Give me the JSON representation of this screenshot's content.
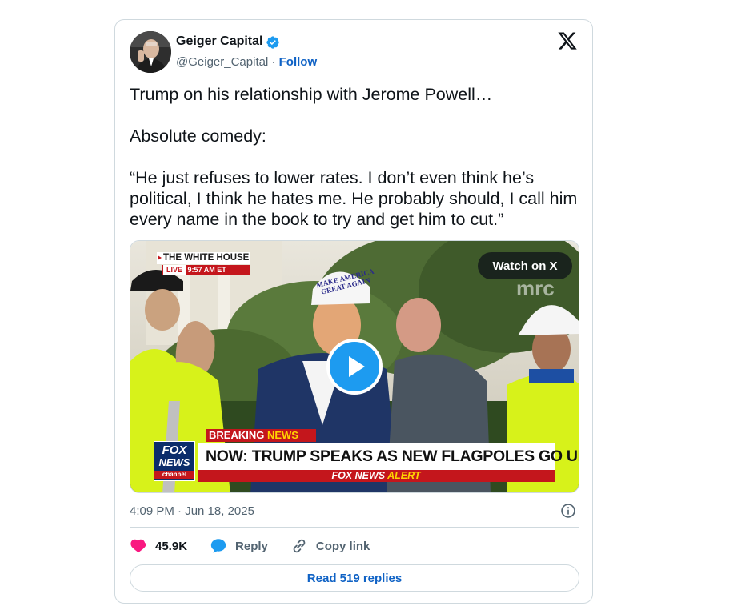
{
  "author": {
    "name": "Geiger Capital",
    "handle": "@Geiger_Capital",
    "separator": "·",
    "follow_label": "Follow"
  },
  "tweet": {
    "paragraphs": [
      "Trump on his relationship with Jerome Powell…",
      "Absolute comedy:",
      "“He just refuses to lower rates. I don’t even think he’s political, I think he hates me. He probably should, I call him every name in the book to try and get him to cut.”"
    ],
    "timestamp": "4:09 PM · Jun 18, 2025"
  },
  "media": {
    "watch_label": "Watch on X",
    "overlay": {
      "white_house": "THE WHITE HOUSE",
      "live": "LIVE",
      "live_time": "9:57 AM ET",
      "watermark": "mrc",
      "hat_line1": "MAKE AMERICA",
      "hat_line2": "GREAT AGAIN",
      "fox_logo_line1": "FOX",
      "fox_logo_line2": "NEWS",
      "fox_logo_line3": "channel",
      "breaking_1": "BREAKING",
      "breaking_2": "NEWS",
      "headline": "NOW: TRUMP SPEAKS AS NEW FLAGPOLES GO UP",
      "alert_1": "FOX NEWS",
      "alert_2": "ALERT"
    }
  },
  "actions": {
    "likes": "45.9K",
    "reply": "Reply",
    "copy_link": "Copy link"
  },
  "read_replies": "Read 519 replies",
  "colors": {
    "accent": "#1d9bf0",
    "link": "#0f62c5",
    "like": "#f91880",
    "muted": "#536471",
    "border": "#cfd9de"
  },
  "icons": [
    "verified-badge-icon",
    "x-logo-icon",
    "play-icon",
    "info-icon",
    "heart-icon",
    "reply-bubble-icon",
    "link-icon"
  ]
}
